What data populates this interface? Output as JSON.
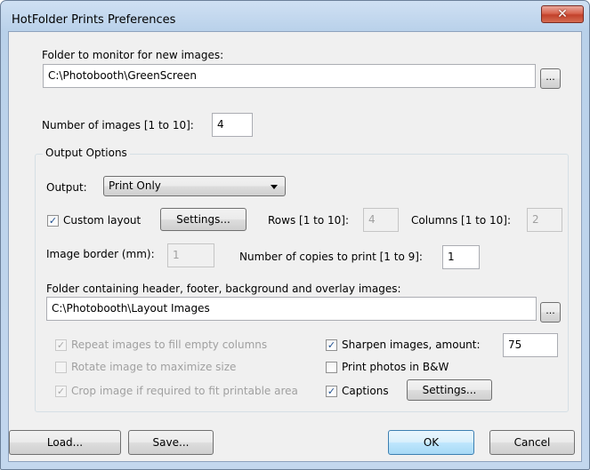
{
  "window": {
    "title": "HotFolder Prints Preferences",
    "close_glyph": "✕"
  },
  "monitor_folder": {
    "label": "Folder to monitor for new images:",
    "value": "C:\\Photobooth\\GreenScreen",
    "browse_label": "..."
  },
  "num_images": {
    "label": "Number of images [1 to 10]:",
    "value": "4"
  },
  "output_options": {
    "group_title": "Output Options",
    "output_label": "Output:",
    "output_value": "Print Only",
    "custom_layout": {
      "label": "Custom layout",
      "checked": true
    },
    "layout_settings_label": "Settings...",
    "rows_label": "Rows [1 to 10]:",
    "rows_value": "4",
    "columns_label": "Columns [1 to 10]:",
    "columns_value": "2",
    "border_label": "Image border (mm):",
    "border_value": "1",
    "copies_label": "Number of copies to print [1 to 9]:",
    "copies_value": "1",
    "layout_folder_label": "Folder containing header, footer, background and overlay images:",
    "layout_folder_value": "C:\\Photobooth\\Layout Images",
    "layout_folder_browse": "...",
    "repeat_images": {
      "label": "Repeat images to fill empty columns",
      "checked": true,
      "enabled": false
    },
    "rotate_image": {
      "label": "Rotate image to maximize size",
      "checked": false,
      "enabled": false
    },
    "crop_image": {
      "label": "Crop image if required to fit printable area",
      "checked": true,
      "enabled": false
    },
    "sharpen": {
      "label": "Sharpen images, amount:",
      "checked": true,
      "amount": "75"
    },
    "bw": {
      "label": "Print photos in B&W",
      "checked": false
    },
    "captions": {
      "label": "Captions",
      "checked": true,
      "settings_label": "Settings..."
    }
  },
  "footer": {
    "load_label": "Load...",
    "save_label": "Save...",
    "ok_label": "OK",
    "cancel_label": "Cancel"
  },
  "icons": {
    "check_glyph": "✓"
  }
}
